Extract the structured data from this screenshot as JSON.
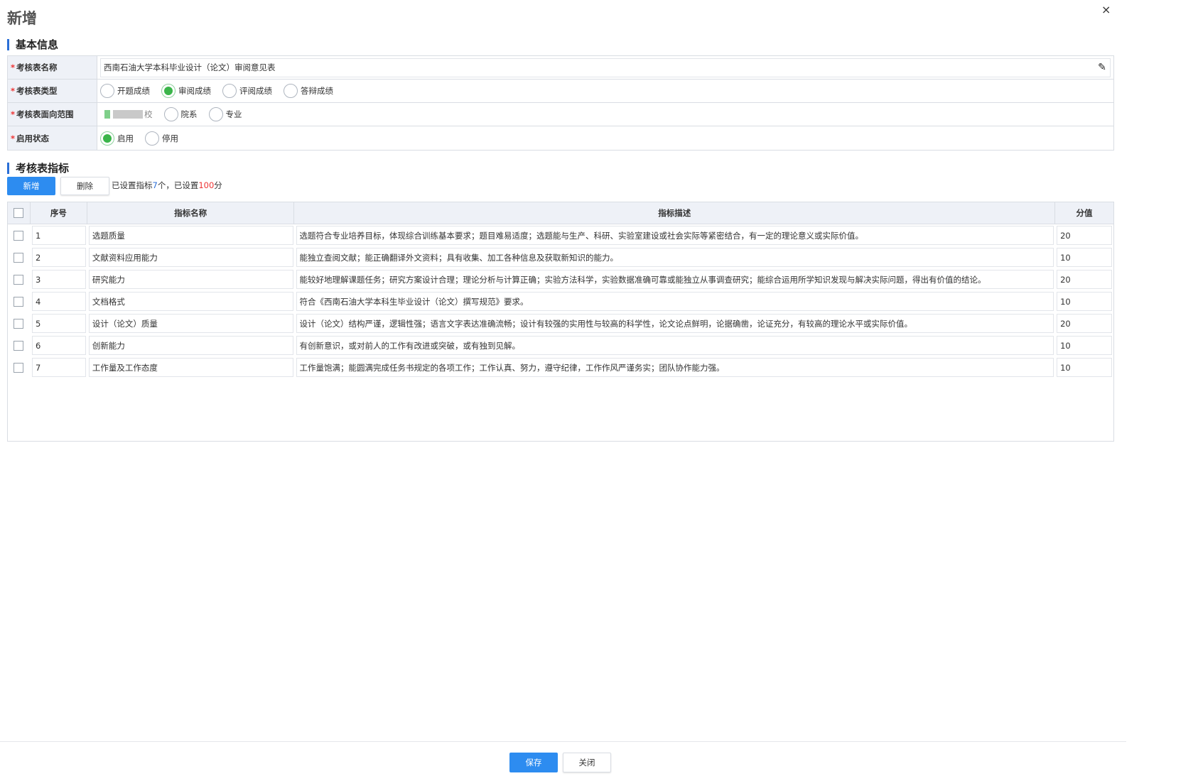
{
  "dialog": {
    "title": "新增",
    "close_icon": "close-icon",
    "close_glyph": "×"
  },
  "basic_info": {
    "section_title": "基本信息",
    "fields": {
      "name": {
        "label": "考核表名称",
        "value": "西南石油大学本科毕业设计（论文）审阅意见表",
        "edit_icon": "pencil-icon"
      },
      "type": {
        "label": "考核表类型",
        "options": [
          "开题成绩",
          "审阅成绩",
          "评阅成绩",
          "答辩成绩"
        ],
        "selected": "审阅成绩"
      },
      "scope": {
        "label": "考核表面向范围",
        "options": [
          "校",
          "院系",
          "专业"
        ],
        "selected": ""
      },
      "status": {
        "label": "启用状态",
        "options": [
          "启用",
          "停用"
        ],
        "selected": "启用"
      }
    }
  },
  "indicators": {
    "section_title": "考核表指标",
    "add_label": "新增",
    "delete_label": "删除",
    "summary": {
      "prefix": "已设置指标",
      "count": "7",
      "mid": "个，已设置",
      "total": "100",
      "suffix": "分"
    },
    "columns": [
      "序号",
      "指标名称",
      "指标描述",
      "分值"
    ],
    "rows": [
      {
        "no": "1",
        "name": "选题质量",
        "desc": "选题符合专业培养目标，体现综合训练基本要求；题目难易适度；选题能与生产、科研、实验室建设或社会实际等紧密结合，有一定的理论意义或实际价值。",
        "score": "20"
      },
      {
        "no": "2",
        "name": "文献资料应用能力",
        "desc": "能独立查阅文献；能正确翻译外文资料；具有收集、加工各种信息及获取新知识的能力。",
        "score": "10"
      },
      {
        "no": "3",
        "name": "研究能力",
        "desc": "能较好地理解课题任务；研究方案设计合理；理论分析与计算正确；实验方法科学，实验数据准确可靠或能独立从事调查研究；能综合运用所学知识发现与解决实际问题，得出有价值的结论。",
        "score": "20"
      },
      {
        "no": "4",
        "name": "文档格式",
        "desc": "符合《西南石油大学本科生毕业设计（论文）撰写规范》要求。",
        "score": "10"
      },
      {
        "no": "5",
        "name": "设计（论文）质量",
        "desc": "设计（论文）结构严谨，逻辑性强；语言文字表达准确流畅；设计有较强的实用性与较高的科学性，论文论点鲜明，论据确凿，论证充分，有较高的理论水平或实际价值。",
        "score": "20"
      },
      {
        "no": "6",
        "name": "创新能力",
        "desc": "有创新意识，或对前人的工作有改进或突破，或有独到见解。",
        "score": "10"
      },
      {
        "no": "7",
        "name": "工作量及工作态度",
        "desc": "工作量饱满；能圆满完成任务书规定的各项工作；工作认真、努力，遵守纪律，工作作风严谨务实；团队协作能力强。",
        "score": "10"
      }
    ]
  },
  "footer": {
    "save_label": "保存",
    "close_label": "关闭"
  },
  "colors": {
    "primary": "#2d8cf0",
    "radio_checked": "#3bb54a",
    "required": "#e33333",
    "header_bg": "#eef1f7"
  }
}
